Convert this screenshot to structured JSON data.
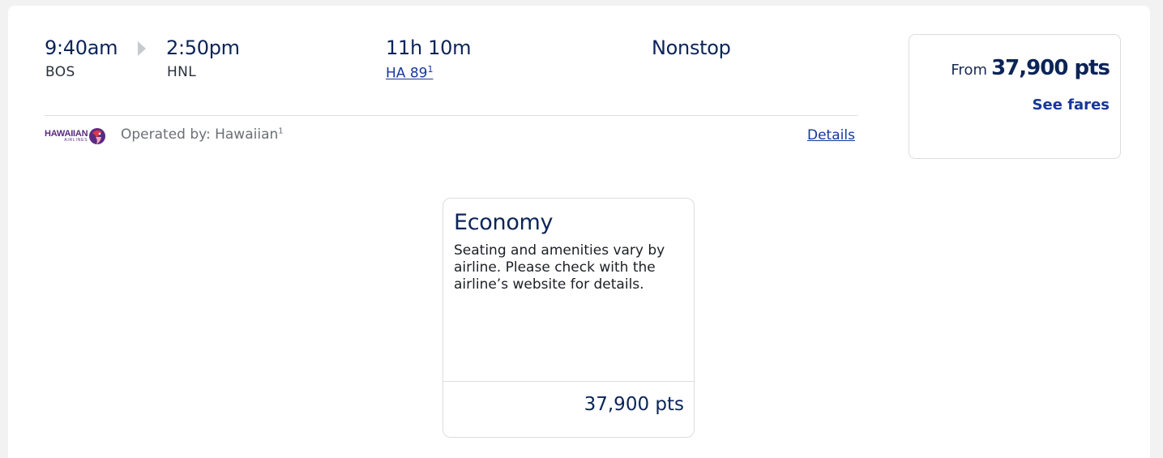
{
  "flight": {
    "depart_time": "9:40am",
    "depart_code": "BOS",
    "arrive_time": "2:50pm",
    "arrive_code": "HNL",
    "duration": "11h 10m",
    "flight_number": "HA 89",
    "flight_number_sup": "1",
    "stops": "Nonstop"
  },
  "operator": {
    "logo_text": "HAWAIIAN",
    "logo_sub": "AIRLINES",
    "operated_by": "Operated by: Hawaiian",
    "operated_sup": "1",
    "details_link": "Details",
    "logo_color": "#5a2a82"
  },
  "price_summary": {
    "from_label": "From",
    "from_value": "37,900 pts",
    "see_fares": "See fares"
  },
  "fare": {
    "cabin": "Economy",
    "description": "Seating and amenities vary by airline. Please check with the airline’s website for details.",
    "price": "37,900 pts"
  },
  "colors": {
    "primary_navy": "#0c2457",
    "link_blue": "#16379b",
    "border": "#dcdde1",
    "background": "#f2f2f3"
  }
}
